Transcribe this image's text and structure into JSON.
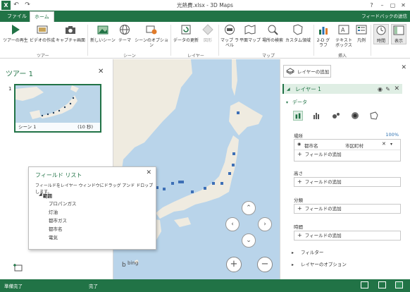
{
  "window": {
    "title": "光熱費.xlsx - 3D Maps",
    "app_icon": "X",
    "controls": [
      "?",
      "–",
      "▢",
      "✕"
    ]
  },
  "ribbon_tabs": [
    {
      "label": "ファイル",
      "active": false
    },
    {
      "label": "ホーム",
      "active": true
    }
  ],
  "feedback_label": "フィードバックの送信",
  "ribbon": {
    "groups": {
      "tour": "ツアー",
      "scene": "シーン",
      "layer": "レイヤー",
      "map": "マップ",
      "insert": "挿入"
    },
    "buttons": {
      "play_tour": "ツアーの再生",
      "create_video": "ビデオの作成",
      "capture_screen": "キャプチャ画面",
      "new_scene": "新しいシーン",
      "theme": "テーマ",
      "scene_options": "シーンのオプション",
      "refresh_data": "データの更新",
      "shapes": "図形",
      "map_labels": "マップ ラベル",
      "flat_map": "平面マップ",
      "find_location": "場所の検索",
      "custom_regions": "カスタム領域",
      "chart_2d": "2-D グラフ",
      "text_box": "テキスト ボックス",
      "legend": "凡例",
      "time": "時間",
      "display": "表示"
    }
  },
  "tour_pane": {
    "title": "ツアー 1",
    "index": "1",
    "scene_name": "シーン 1",
    "scene_duration": "(10 秒)"
  },
  "field_list": {
    "title": "フィールド リスト",
    "instruction": "フィールドをレイヤー ウィンドウにドラッグ アンド ドロップします。",
    "group": "範囲",
    "items": [
      "プロパンガス",
      "灯油",
      "都市ガス",
      "都市名",
      "電気"
    ]
  },
  "map": {
    "provider": "bing"
  },
  "layer_pane": {
    "add_layer": "レイヤーの追加",
    "layer_name": "レイヤー 1",
    "data_section": "データ",
    "location_label": "場所",
    "location_percent": "100%",
    "location_field": "都市名",
    "location_type": "市区町村",
    "add_field": "フィールドの追加",
    "height_label": "高さ",
    "category_label": "分類",
    "time_label": "時間",
    "filter": "フィルター",
    "layer_options": "レイヤーのオプション"
  },
  "status": {
    "left": "準備完了",
    "center": "完了"
  }
}
